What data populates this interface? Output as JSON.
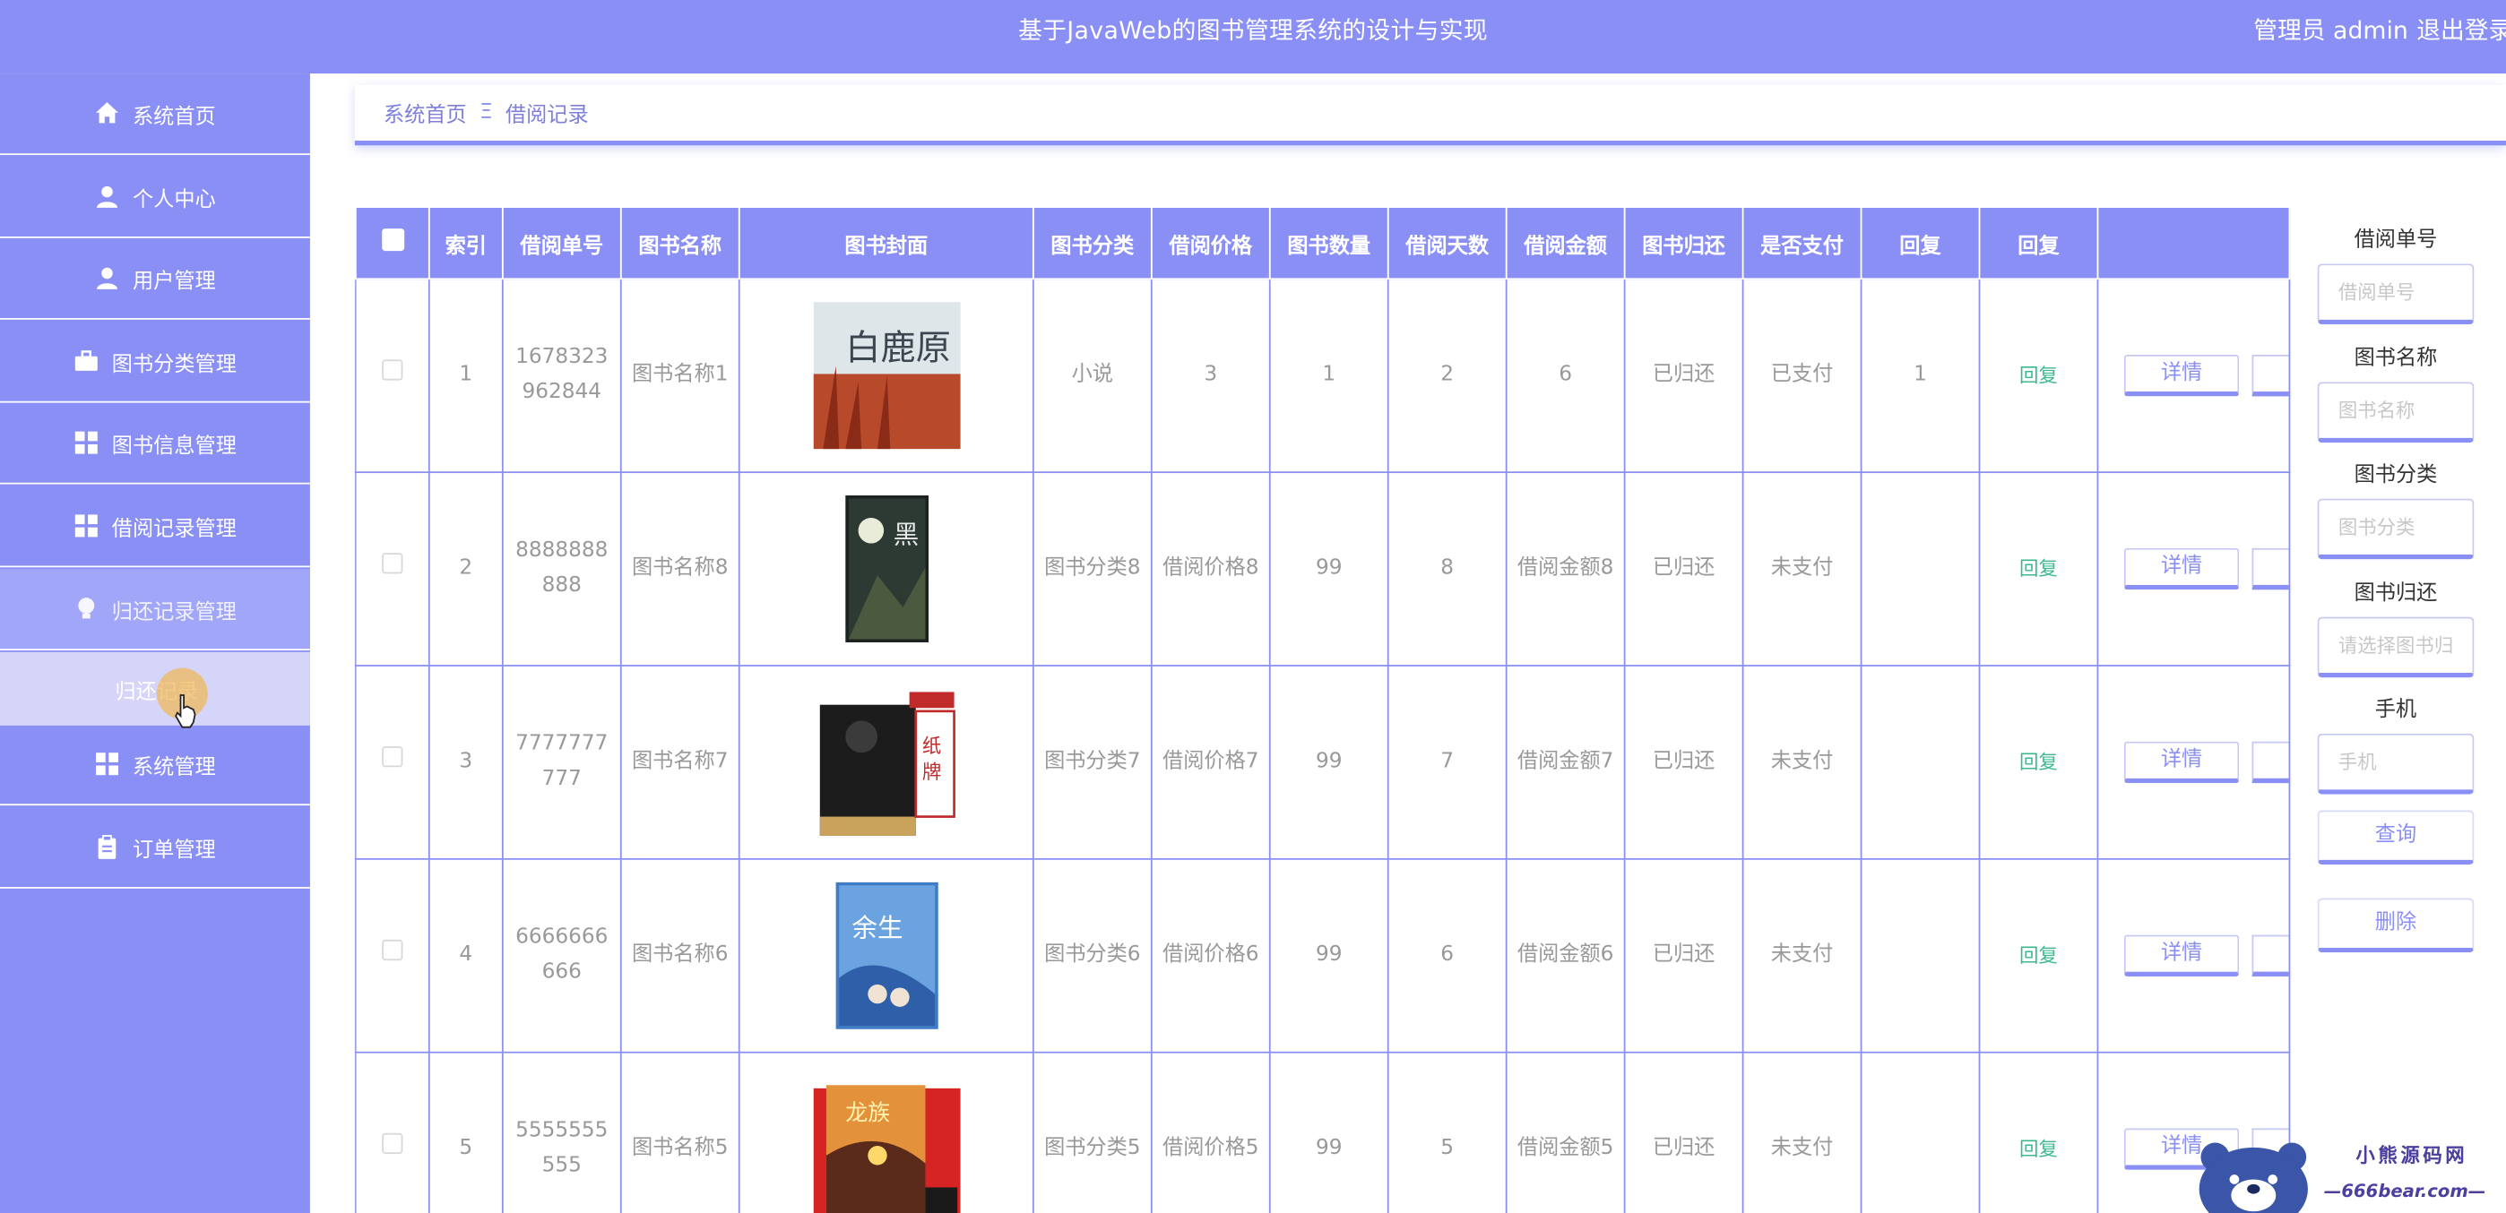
{
  "header": {
    "title": "基于JavaWeb的图书管理系统的设计与实现",
    "admin_label": "管理员 admin",
    "logout_label": "退出登录"
  },
  "sidebar": {
    "items": [
      {
        "label": "系统首页",
        "icon": "home-icon"
      },
      {
        "label": "个人中心",
        "icon": "user-icon"
      },
      {
        "label": "用户管理",
        "icon": "user-icon"
      },
      {
        "label": "图书分类管理",
        "icon": "briefcase-icon"
      },
      {
        "label": "图书信息管理",
        "icon": "grid-icon"
      },
      {
        "label": "借阅记录管理",
        "icon": "grid-icon"
      },
      {
        "label": "归还记录管理",
        "icon": "bulb-icon"
      },
      {
        "label": "系统管理",
        "icon": "grid-icon"
      },
      {
        "label": "订单管理",
        "icon": "clipboard-icon"
      }
    ],
    "submenu_label": "归还记录"
  },
  "breadcrumb": {
    "home": "系统首页",
    "separator": "Ξ",
    "current": "借阅记录"
  },
  "table": {
    "columns": [
      "索引",
      "借阅单号",
      "图书名称",
      "图书封面",
      "图书分类",
      "借阅价格",
      "图书数量",
      "借阅天数",
      "借阅金额",
      "图书归还",
      "是否支付",
      "回复",
      "回复"
    ],
    "rows": [
      {
        "index": "1",
        "order_no": "1678323962844",
        "book_name": "图书名称1",
        "category": "小说",
        "price": "3",
        "quantity": "1",
        "days": "2",
        "amount": "6",
        "returned": "已归还",
        "paid": "已支付",
        "reply": "1",
        "reply_btn": "回复",
        "detail": "详情",
        "cover": "cover-1"
      },
      {
        "index": "2",
        "order_no": "8888888888",
        "book_name": "图书名称8",
        "category": "图书分类8",
        "price": "借阅价格8",
        "quantity": "99",
        "days": "8",
        "amount": "借阅金额8",
        "returned": "已归还",
        "paid": "未支付",
        "reply": "",
        "reply_btn": "回复",
        "detail": "详情",
        "cover": "cover-2"
      },
      {
        "index": "3",
        "order_no": "7777777777",
        "book_name": "图书名称7",
        "category": "图书分类7",
        "price": "借阅价格7",
        "quantity": "99",
        "days": "7",
        "amount": "借阅金额7",
        "returned": "已归还",
        "paid": "未支付",
        "reply": "",
        "reply_btn": "回复",
        "detail": "详情",
        "cover": "cover-3"
      },
      {
        "index": "4",
        "order_no": "6666666666",
        "book_name": "图书名称6",
        "category": "图书分类6",
        "price": "借阅价格6",
        "quantity": "99",
        "days": "6",
        "amount": "借阅金额6",
        "returned": "已归还",
        "paid": "未支付",
        "reply": "",
        "reply_btn": "回复",
        "detail": "详情",
        "cover": "cover-4"
      },
      {
        "index": "5",
        "order_no": "5555555555",
        "book_name": "图书名称5",
        "category": "图书分类5",
        "price": "借阅价格5",
        "quantity": "99",
        "days": "5",
        "amount": "借阅金额5",
        "returned": "已归还",
        "paid": "未支付",
        "reply": "",
        "reply_btn": "回复",
        "detail": "详情",
        "cover": "cover-5"
      }
    ]
  },
  "search": {
    "fields": [
      {
        "label": "借阅单号",
        "placeholder": "借阅单号"
      },
      {
        "label": "图书名称",
        "placeholder": "图书名称"
      },
      {
        "label": "图书分类",
        "placeholder": "图书分类"
      },
      {
        "label": "图书归还",
        "placeholder": "请选择图书归"
      },
      {
        "label": "手机",
        "placeholder": "手机"
      }
    ],
    "query_label": "查询",
    "delete_label": "删除"
  },
  "watermark": {
    "line1": "小熊源码网",
    "line2": "—666bear.com—"
  },
  "colors": {
    "accent": "#8a8ff6",
    "reply_green": "#3cb98c"
  }
}
